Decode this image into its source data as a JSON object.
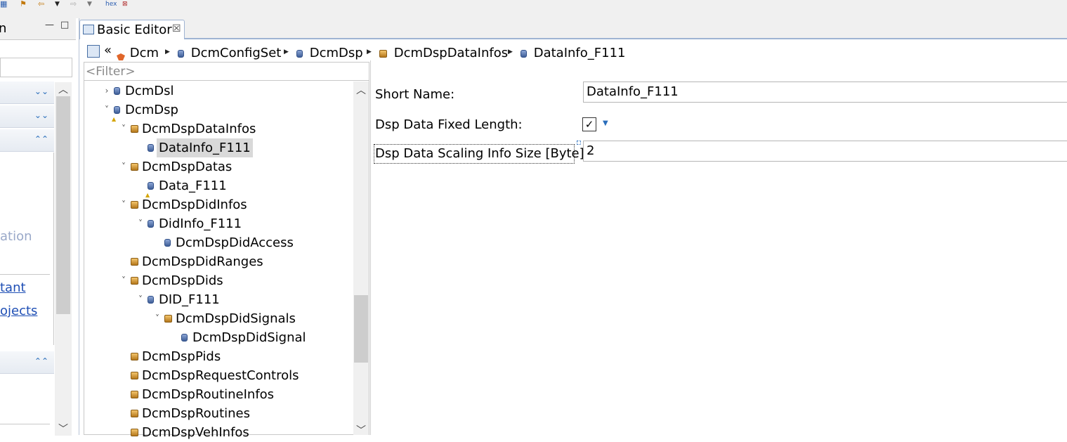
{
  "toolbar": {
    "icons": [
      "nav-flag-icon",
      "back-arrow-icon",
      "dropdown-arrow-icon",
      "forward-arrow-icon",
      "hex-icon",
      "binary-icon"
    ],
    "hex_label": "hex"
  },
  "left_panel": {
    "tab_title": "n Re...",
    "minimize": "—",
    "maximize": "□",
    "partial_link_1": "ation",
    "partial_link_2": "tant",
    "partial_link_3": "ojects"
  },
  "editor": {
    "tab_title": "Basic Editor",
    "tab_close": "☒",
    "breadcrumb": [
      {
        "label": "Dcm",
        "icon": "module-icon"
      },
      {
        "label": "DcmConfigSet",
        "icon": "node-icon"
      },
      {
        "label": "DcmDsp",
        "icon": "node-icon"
      },
      {
        "label": "DcmDspDataInfos",
        "icon": "container-icon"
      },
      {
        "label": "DataInfo_F111",
        "icon": "node-icon"
      }
    ],
    "breadcrumb_back": "«"
  },
  "tree": {
    "filter_placeholder": "<Filter>",
    "rows": [
      {
        "label": "DcmDsl",
        "level": 3,
        "toggle": "›",
        "icon": "node"
      },
      {
        "label": "DcmDsp",
        "level": 3,
        "toggle": "˅",
        "icon": "node-warn"
      },
      {
        "label": "DcmDspDataInfos",
        "level": 4,
        "toggle": "˅",
        "icon": "container"
      },
      {
        "label": "DataInfo_F111",
        "level": 5,
        "toggle": "",
        "icon": "node",
        "selected": true
      },
      {
        "label": "DcmDspDatas",
        "level": 4,
        "toggle": "˅",
        "icon": "container"
      },
      {
        "label": "Data_F111",
        "level": 5,
        "toggle": "",
        "icon": "node-warn"
      },
      {
        "label": "DcmDspDidInfos",
        "level": 4,
        "toggle": "˅",
        "icon": "container"
      },
      {
        "label": "DidInfo_F111",
        "level": 5,
        "toggle": "˅",
        "icon": "node"
      },
      {
        "label": "DcmDspDidAccess",
        "level": 6,
        "toggle": "",
        "icon": "node"
      },
      {
        "label": "DcmDspDidRanges",
        "level": 4,
        "toggle": "",
        "icon": "container"
      },
      {
        "label": "DcmDspDids",
        "level": 4,
        "toggle": "˅",
        "icon": "container"
      },
      {
        "label": "DID_F111",
        "level": 5,
        "toggle": "˅",
        "icon": "node"
      },
      {
        "label": "DcmDspDidSignals",
        "level": 6,
        "toggle": "˅",
        "icon": "container"
      },
      {
        "label": "DcmDspDidSignal",
        "level": 7,
        "toggle": "",
        "icon": "node"
      },
      {
        "label": "DcmDspPids",
        "level": 4,
        "toggle": "",
        "icon": "container"
      },
      {
        "label": "DcmDspRequestControls",
        "level": 4,
        "toggle": "",
        "icon": "container"
      },
      {
        "label": "DcmDspRoutineInfos",
        "level": 4,
        "toggle": "",
        "icon": "container"
      },
      {
        "label": "DcmDspRoutines",
        "level": 4,
        "toggle": "",
        "icon": "container"
      },
      {
        "label": "DcmDspVehInfos",
        "level": 4,
        "toggle": "",
        "icon": "container"
      }
    ]
  },
  "form": {
    "short_name_label": "Short Name:",
    "short_name_value": "DataInfo_F111",
    "fixed_length_label": "Dsp Data Fixed Length:",
    "fixed_length_checked": "✓",
    "scaling_label": "Dsp Data Scaling Info Size [Byte]:",
    "scaling_value": "2"
  }
}
